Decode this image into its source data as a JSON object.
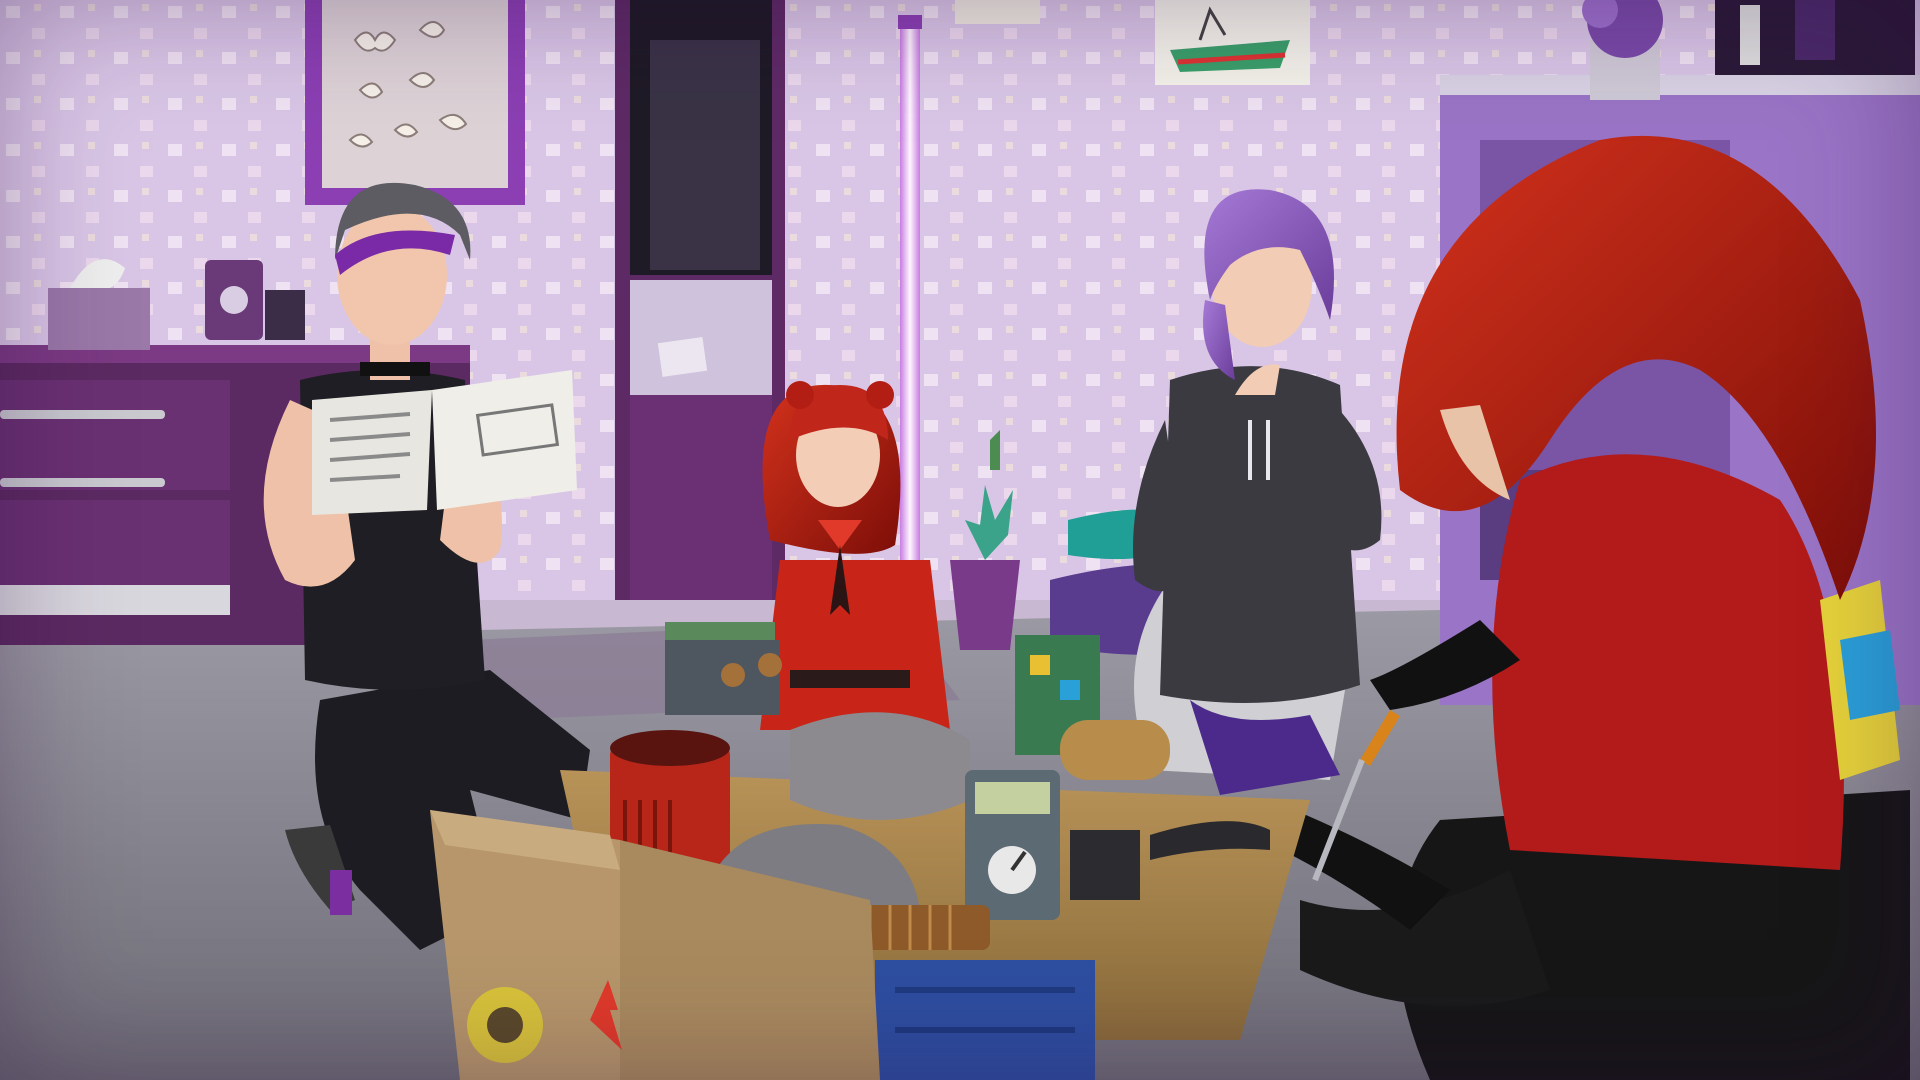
{
  "scene": {
    "title": "",
    "hud_visible": false,
    "setting": "bedroom",
    "colors": {
      "wall": "#d9c6e6",
      "wall_spot": "#f2e4f4",
      "floor": "#8e8c96",
      "dresser": "#5c2a62",
      "shelf": "#9a74c6",
      "hair_red": "#b81d10",
      "hair_purple": "#8a5bc0",
      "sweater_red": "#b31a1a",
      "hoodie_gray": "#3a3a40",
      "neon": "#f6e8ff"
    },
    "icons": [
      "tissue-box-icon",
      "butterfly-icon",
      "wrench-icon",
      "screwdriver-icon",
      "multimeter-icon"
    ]
  },
  "book": {
    "header_text": "",
    "body_text": ""
  },
  "box_label": ""
}
